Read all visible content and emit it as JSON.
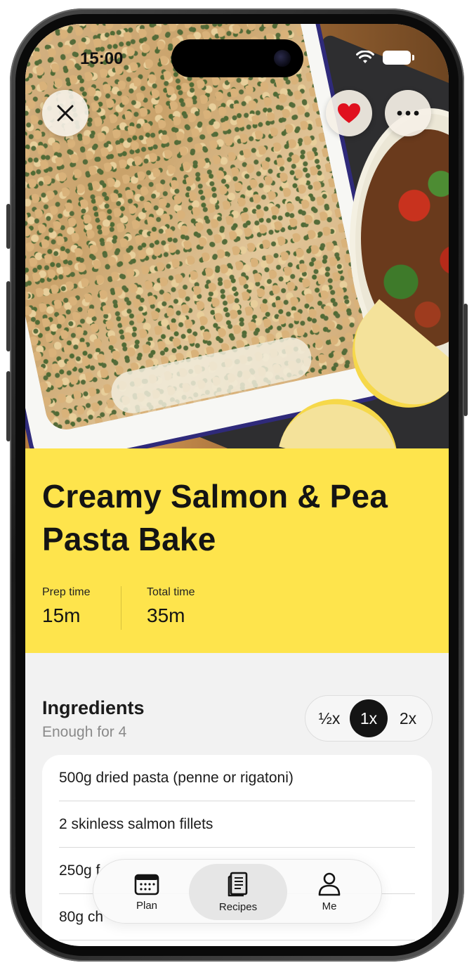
{
  "status_bar": {
    "time": "15:00"
  },
  "recipe": {
    "title": "Creamy Salmon & Pea Pasta Bake",
    "title_line1": "Creamy Salmon & Pea",
    "title_line2": "Pasta Bake",
    "prep_time_label": "Prep time",
    "prep_time_value": "15m",
    "total_time_label": "Total time",
    "total_time_value": "35m"
  },
  "ingredients": {
    "heading": "Ingredients",
    "servings_text": "Enough for 4",
    "scale_options": [
      "½x",
      "1x",
      "2x"
    ],
    "selected_scale": "1x",
    "items": [
      "500g dried pasta (penne or rigatoni)",
      "2 skinless salmon fillets",
      "250g f",
      "80g ch"
    ]
  },
  "tabbar": {
    "tabs": [
      {
        "label": "Plan",
        "icon": "calendar-icon"
      },
      {
        "label": "Recipes",
        "icon": "book-icon"
      },
      {
        "label": "Me",
        "icon": "person-icon"
      }
    ],
    "active": "Recipes"
  },
  "colors": {
    "accent_yellow": "#fee44c",
    "heart_red": "#e0101e",
    "text_dark": "#141414",
    "muted": "#8a8a8a"
  }
}
